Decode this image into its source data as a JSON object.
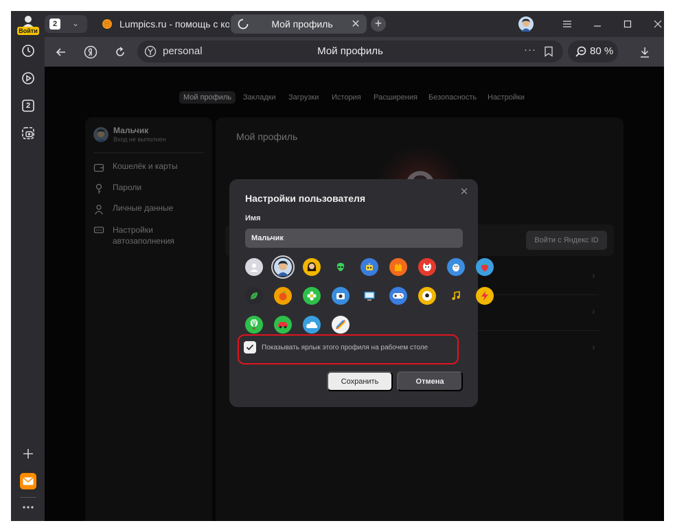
{
  "sidebar": {
    "login_label": "Войти",
    "counter": "2",
    "icons": [
      "history-icon",
      "play-icon",
      "counter-icon",
      "screenshot-icon",
      "plus-icon",
      "mail-icon",
      "more-icon"
    ]
  },
  "tabs": {
    "count": "2",
    "items": [
      {
        "title": "Lumpics.ru - помощь с ко",
        "favicon": "orange-circle"
      },
      {
        "title": "Мой профиль",
        "favicon": "loading-spinner"
      }
    ]
  },
  "addressbar": {
    "url": "personal",
    "page_title": "Мой профиль",
    "zoom": "80 %"
  },
  "page": {
    "nav": [
      "Мой профиль",
      "Закладки",
      "Загрузки",
      "История",
      "Расширения",
      "Безопасность",
      "Настройки"
    ],
    "left": {
      "profile_name": "Мальчик",
      "profile_status": "Вход не выполнен",
      "items": [
        {
          "label": "Кошелёк и карты",
          "icon": "wallet-icon"
        },
        {
          "label": "Пароли",
          "icon": "key-icon"
        },
        {
          "label": "Личные данные",
          "icon": "person-icon"
        },
        {
          "label": "Настройки автозаполнения",
          "icon": "autofill-icon"
        }
      ]
    },
    "right": {
      "title": "Мой профиль",
      "login_button": "Войти с Яндекс ID"
    }
  },
  "modal": {
    "title": "Настройки пользователя",
    "name_label": "Имя",
    "name_value": "Мальчик",
    "checkbox_label": "Показывать ярлык этого профиля на рабочем столе",
    "checkbox_checked": true,
    "save": "Сохранить",
    "cancel": "Отмена",
    "selected_avatar": "boy",
    "avatars": [
      {
        "name": "default-person",
        "color": "#d8d8e0"
      },
      {
        "name": "boy",
        "color": "#2f4a7a"
      },
      {
        "name": "girl",
        "color": "#f2b700"
      },
      {
        "name": "alien",
        "color": "#2e2e32"
      },
      {
        "name": "robot",
        "color": "#3b7ddd"
      },
      {
        "name": "fox-hand",
        "color": "#f26b1d"
      },
      {
        "name": "cat-red",
        "color": "#e63a2e"
      },
      {
        "name": "bird",
        "color": "#3c8de0"
      },
      {
        "name": "strawberry",
        "color": "#3aa0e0"
      },
      {
        "name": "leaf",
        "color": "#2a2a2e"
      },
      {
        "name": "orange-fruit",
        "color": "#f2a000"
      },
      {
        "name": "flower",
        "color": "#2ec04a"
      },
      {
        "name": "camera",
        "color": "#3a8ee0"
      },
      {
        "name": "monitor",
        "color": "#2e2e32"
      },
      {
        "name": "gamepad",
        "color": "#3a7ee0"
      },
      {
        "name": "soccer-ball",
        "color": "#f2b700"
      },
      {
        "name": "music-note",
        "color": "#2e2e32"
      },
      {
        "name": "lightning",
        "color": "#f2b700"
      },
      {
        "name": "balloon",
        "color": "#2ec04a"
      },
      {
        "name": "car",
        "color": "#2ec04a"
      },
      {
        "name": "cloud",
        "color": "#3aa0e0"
      },
      {
        "name": "rainbow",
        "color": "#f2f2f2"
      }
    ]
  }
}
